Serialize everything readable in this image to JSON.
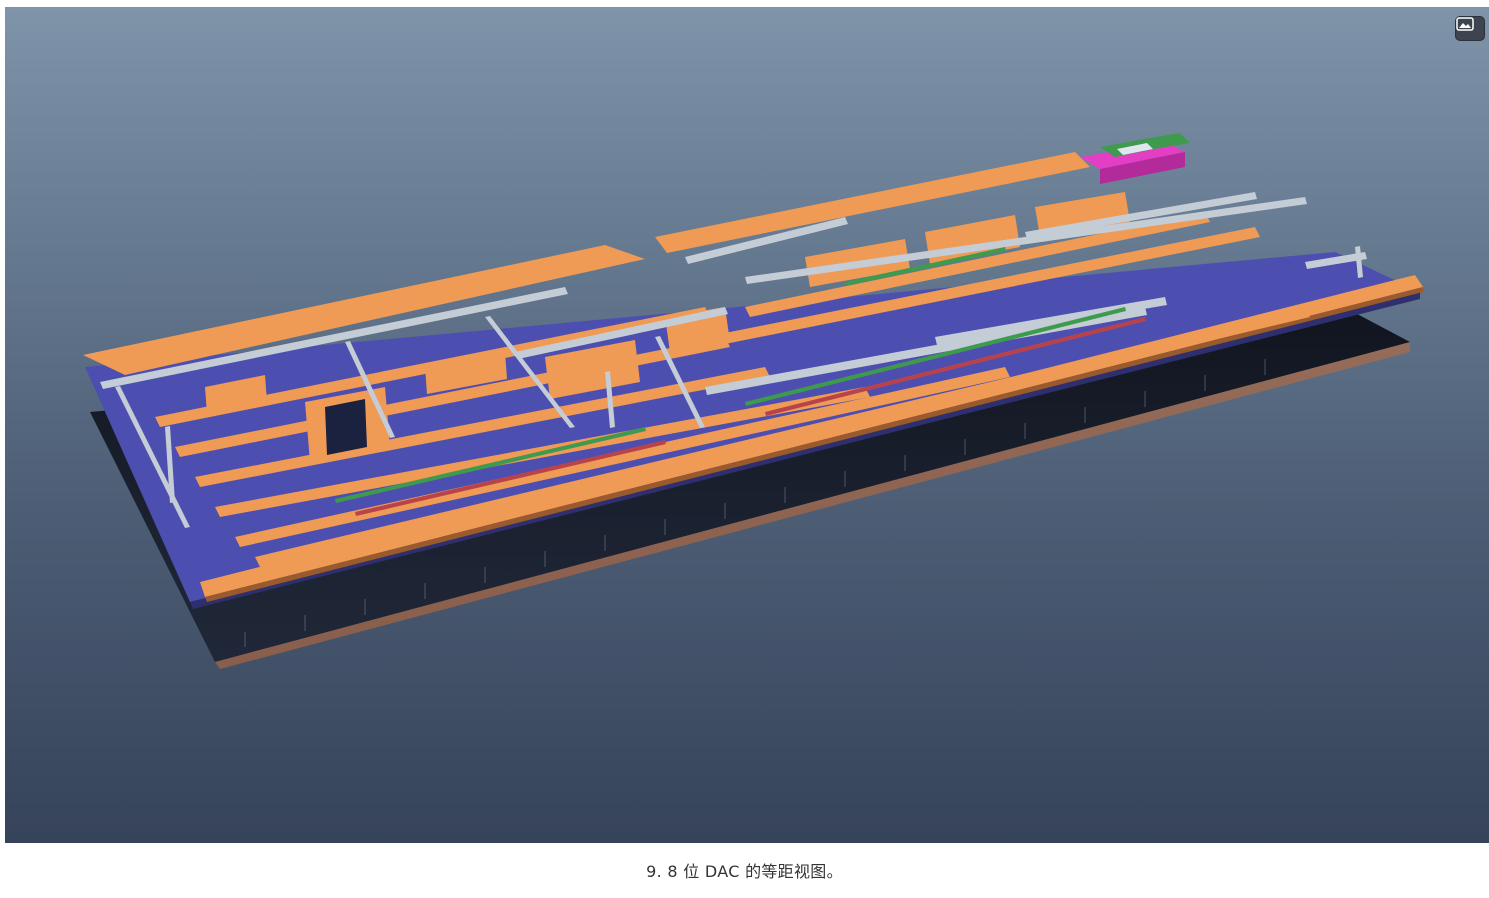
{
  "figure": {
    "caption": "9. 8 位 DAC 的等距视图。",
    "image_alt_icon": "image-icon",
    "colors": {
      "background_top": "#7f94a9",
      "background_bottom": "#36435a",
      "metal_orange": "#ef9a55",
      "metal_grey": "#c4ccd6",
      "substrate_blue": "#4d4fb0",
      "accent_green": "#3e9a4c",
      "accent_magenta": "#e23fc4"
    }
  }
}
